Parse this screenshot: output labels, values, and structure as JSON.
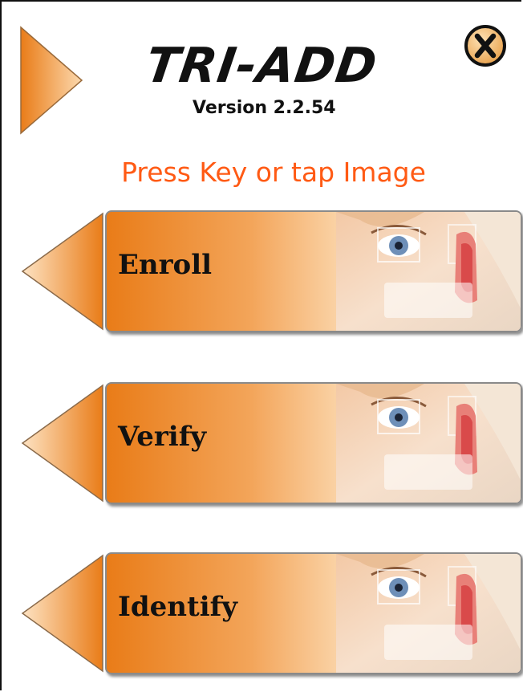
{
  "app": {
    "title": "TRI-ADD",
    "version": "Version 2.2.54"
  },
  "prompt": "Press Key or tap Image",
  "actions": [
    {
      "label": "Enroll"
    },
    {
      "label": "Verify"
    },
    {
      "label": "Identify"
    }
  ],
  "colors": {
    "accent": "#ff5a14",
    "orange": "#e97c18"
  },
  "icons": {
    "nav": "play-arrow-icon",
    "close": "close-x-icon",
    "action_arrow": "left-arrow-icon",
    "action_image": "biometric-face-image"
  }
}
